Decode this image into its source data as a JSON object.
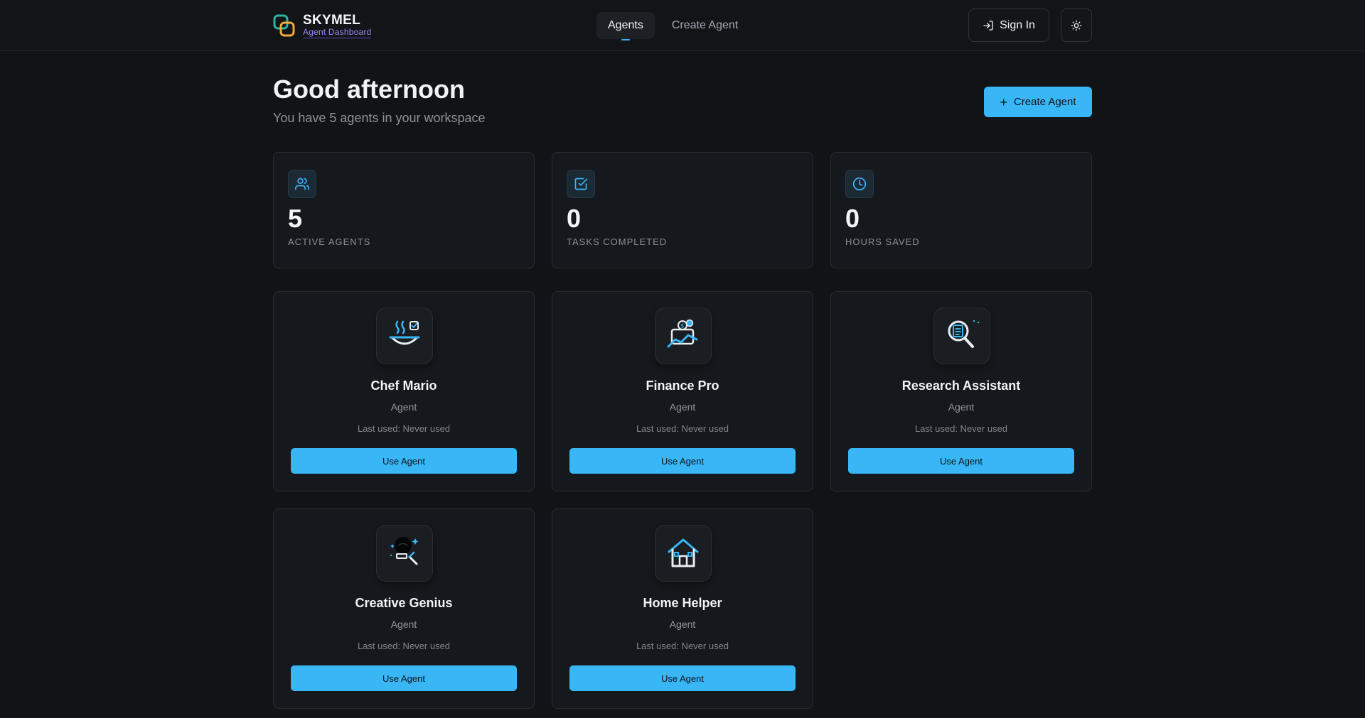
{
  "brand": {
    "name": "SKYMEL",
    "subtitle": "Agent Dashboard"
  },
  "nav": {
    "items": [
      {
        "label": "Agents",
        "active": true
      },
      {
        "label": "Create Agent",
        "active": false
      }
    ]
  },
  "header": {
    "sign_in_label": "Sign In",
    "theme_icon": "sun-icon"
  },
  "greeting": {
    "title": "Good afternoon",
    "subtitle": "You have 5 agents in your workspace"
  },
  "create_button_label": "Create Agent",
  "stats": [
    {
      "value": "5",
      "label": "ACTIVE AGENTS",
      "icon": "users-icon"
    },
    {
      "value": "0",
      "label": "TASKS COMPLETED",
      "icon": "check-square-icon"
    },
    {
      "value": "0",
      "label": "HOURS SAVED",
      "icon": "clock-icon"
    }
  ],
  "agents": [
    {
      "name": "Chef Mario",
      "role": "Agent",
      "last_used": "Last used: Never used",
      "button": "Use Agent",
      "icon": "chef-bowl-icon"
    },
    {
      "name": "Finance Pro",
      "role": "Agent",
      "last_used": "Last used: Never used",
      "button": "Use Agent",
      "icon": "finance-chart-icon"
    },
    {
      "name": "Research Assistant",
      "role": "Agent",
      "last_used": "Last used: Never used",
      "button": "Use Agent",
      "icon": "magnifier-document-icon"
    },
    {
      "name": "Creative Genius",
      "role": "Agent",
      "last_used": "Last used: Never used",
      "button": "Use Agent",
      "icon": "magic-wand-icon"
    },
    {
      "name": "Home Helper",
      "role": "Agent",
      "last_used": "Last used: Never used",
      "button": "Use Agent",
      "icon": "house-icon"
    }
  ],
  "colors": {
    "accent": "#38b6f5",
    "background": "#111316",
    "card": "#15181c",
    "brand_sub": "#9a88f0"
  }
}
